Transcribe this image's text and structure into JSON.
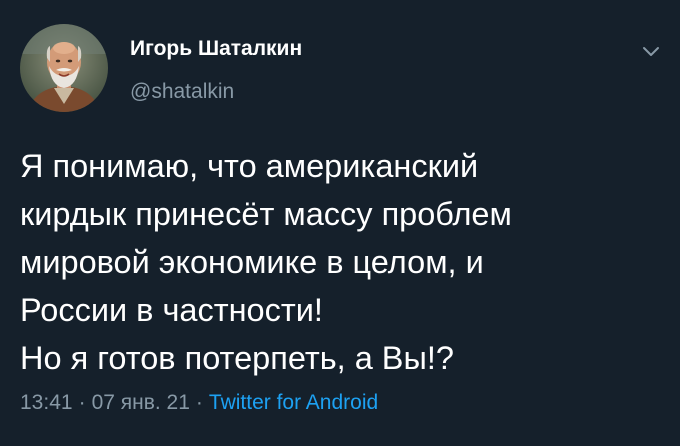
{
  "author": {
    "name": "Игорь Шаталкин",
    "handle": "@shatalkin"
  },
  "tweet": {
    "lines": [
      "Я понимаю, что американский",
      "кирдык принесёт массу проблем",
      "мировой экономике в целом, и",
      "России в частности!",
      "Но я готов потерпеть, а Вы!?"
    ],
    "time": "13:41",
    "date": "07 янв. 21",
    "separator": "·",
    "source": "Twitter for Android"
  },
  "icons": {
    "menu": "chevron-down-icon",
    "avatar": "avatar"
  },
  "colors": {
    "background": "#15202b",
    "text": "#ffffff",
    "muted": "#8899a6",
    "link": "#1da1f2"
  }
}
